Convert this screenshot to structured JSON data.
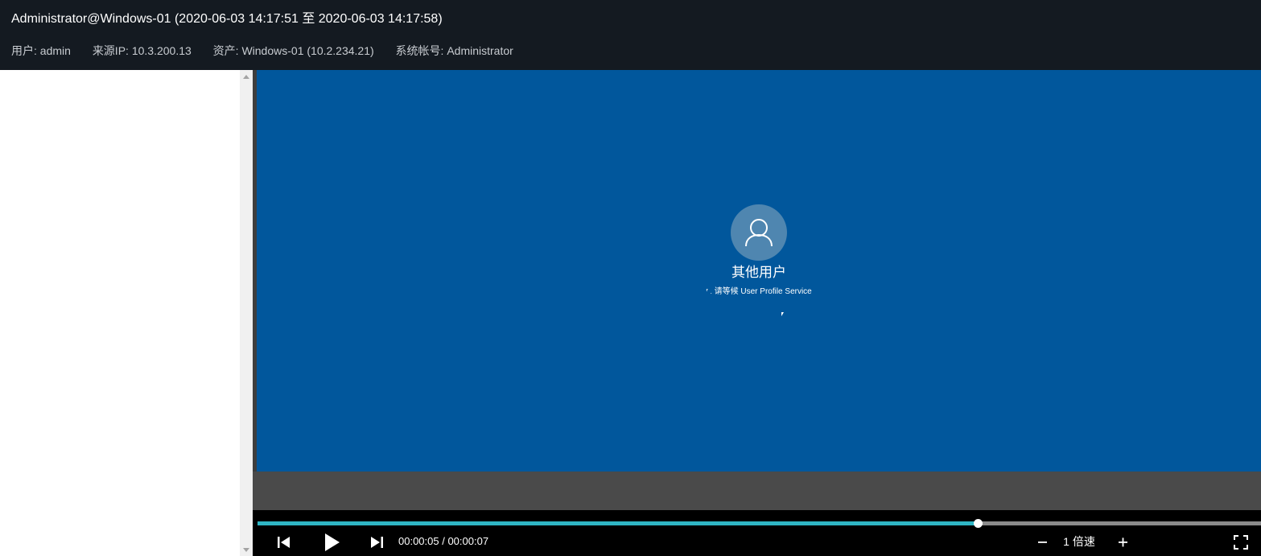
{
  "header": {
    "title": "Administrator@Windows-01 (2020-06-03 14:17:51 至 2020-06-03 14:17:58)",
    "user": "用户: admin",
    "source_ip": "来源IP: 10.3.200.13",
    "asset": "资产: Windows-01 (10.2.234.21)",
    "system_account": "系统帐号: Administrator"
  },
  "screen": {
    "background_color": "#01579c",
    "avatar_icon": "user-icon",
    "user_name": "其他用户",
    "status_text": "请等候 User Profile Service"
  },
  "player": {
    "progress": 0.718,
    "time": "00:00:05 / 00:00:07",
    "speed": "1 倍速",
    "accent_color": "#2fb5c4",
    "icons": [
      "skip-back-icon",
      "play-icon",
      "skip-forward-icon",
      "minus-icon",
      "plus-icon",
      "fullscreen-icon"
    ]
  }
}
